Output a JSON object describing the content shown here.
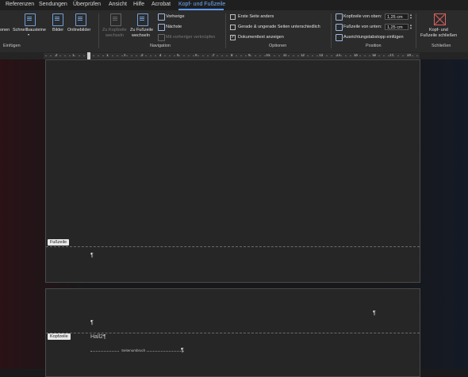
{
  "menubar": {
    "tabs": [
      "Referenzen",
      "Sendungen",
      "Überprüfen",
      "Ansicht",
      "Hilfe",
      "Acrobat",
      "Kopf- und Fußzeile"
    ],
    "active": "Kopf- und Fußzeile"
  },
  "ribbon": {
    "insert": {
      "partial_label": "onen",
      "quickparts": "Schnellbausteine",
      "pictures": "Bilder",
      "online_pictures": "Onlinebilder",
      "group": "Einfügen"
    },
    "navigation": {
      "goto_header_line1": "Zu Kopfzeile",
      "goto_header_line2": "wechseln",
      "goto_footer_line1": "Zu Fußzeile",
      "goto_footer_line2": "wechseln",
      "previous": "Vorherige",
      "next": "Nächste",
      "link_previous": "Mit vorheriger verknüpfen",
      "group": "Navigation"
    },
    "options": {
      "different_first": "Erste Seite anders",
      "different_odd_even": "Gerade & ungerade Seiten unterschiedlich",
      "show_document_text": "Dokumenttext anzeigen",
      "group": "Optionen"
    },
    "position": {
      "header_from_top_label": "Kopfzeile von oben:",
      "header_from_top_value": "1,25 cm",
      "footer_from_bottom_label": "Fußzeile von unten:",
      "footer_from_bottom_value": "1,25 cm",
      "insert_alignment_tab": "Ausrichtungstabstopp einfügen",
      "group": "Position"
    },
    "close": {
      "line1": "Kopf- und",
      "line2": "Fußzeile schließen",
      "group": "Schließen"
    }
  },
  "checkboxes": {
    "different_first": false,
    "different_odd_even": false,
    "show_document_text": true
  },
  "ruler": {
    "numbers": [
      "1",
      "2",
      "1",
      "2",
      "3",
      "4",
      "5",
      "6",
      "7",
      "8",
      "9",
      "10",
      "11",
      "12",
      "13",
      "14",
      "15",
      "16",
      "17",
      "18"
    ]
  },
  "document": {
    "footer_tag": "Fußzeile",
    "header_tag": "Kopfzeile",
    "pilcrow": "¶",
    "body_text": "Hall2¶",
    "page_break": "Seitenumbruch",
    "header_pilcrow": "¶"
  }
}
